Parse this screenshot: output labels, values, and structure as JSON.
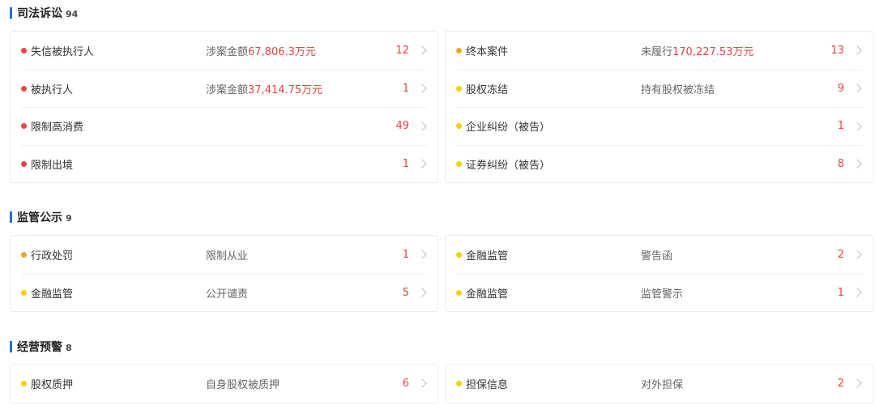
{
  "sections": [
    {
      "title": "司法诉讼",
      "count": "94",
      "cards": [
        [
          {
            "label": "失信被执行人",
            "desc_prefix": "涉案金额",
            "desc_amount": "67,806.3万元",
            "count": "12",
            "dot": "red"
          },
          {
            "label": "被执行人",
            "desc_prefix": "涉案金额",
            "desc_amount": "37,414.75万元",
            "count": "1",
            "dot": "red"
          },
          {
            "label": "限制高消费",
            "desc_prefix": "",
            "desc_amount": "",
            "count": "49",
            "dot": "red"
          },
          {
            "label": "限制出境",
            "desc_prefix": "",
            "desc_amount": "",
            "count": "1",
            "dot": "red"
          }
        ],
        [
          {
            "label": "终本案件",
            "desc_prefix": "未履行",
            "desc_amount": "170,227.53万元",
            "count": "13",
            "dot": "orange"
          },
          {
            "label": "股权冻结",
            "desc_prefix": "持有股权被冻结",
            "desc_amount": "",
            "count": "9",
            "dot": "yellow"
          },
          {
            "label": "企业纠纷（被告）",
            "desc_prefix": "",
            "desc_amount": "",
            "count": "1",
            "dot": "yellow"
          },
          {
            "label": "证券纠纷（被告）",
            "desc_prefix": "",
            "desc_amount": "",
            "count": "8",
            "dot": "yellow"
          }
        ]
      ]
    },
    {
      "title": "监管公示",
      "count": "9",
      "cards": [
        [
          {
            "label": "行政处罚",
            "desc_prefix": "限制从业",
            "desc_amount": "",
            "count": "1",
            "dot": "orange"
          },
          {
            "label": "金融监管",
            "desc_prefix": "公开谴责",
            "desc_amount": "",
            "count": "5",
            "dot": "yellow"
          }
        ],
        [
          {
            "label": "金融监管",
            "desc_prefix": "警告函",
            "desc_amount": "",
            "count": "2",
            "dot": "yellow"
          },
          {
            "label": "金融监管",
            "desc_prefix": "监管警示",
            "desc_amount": "",
            "count": "1",
            "dot": "yellow"
          }
        ]
      ]
    },
    {
      "title": "经营预警",
      "count": "8",
      "cards": [
        [
          {
            "label": "股权质押",
            "desc_prefix": "自身股权被质押",
            "desc_amount": "",
            "count": "6",
            "dot": "yellow"
          }
        ],
        [
          {
            "label": "担保信息",
            "desc_prefix": "对外担保",
            "desc_amount": "",
            "count": "2",
            "dot": "yellow"
          }
        ]
      ]
    }
  ],
  "colors": {
    "accent": "#1d6fe0",
    "red_text": "#e8453c",
    "dot_red": "#ef4444",
    "dot_orange": "#f5a623",
    "dot_yellow": "#f8d000"
  },
  "icons": {
    "row_chevron": "chevron-right-icon",
    "row_dot": "status-dot-icon"
  }
}
